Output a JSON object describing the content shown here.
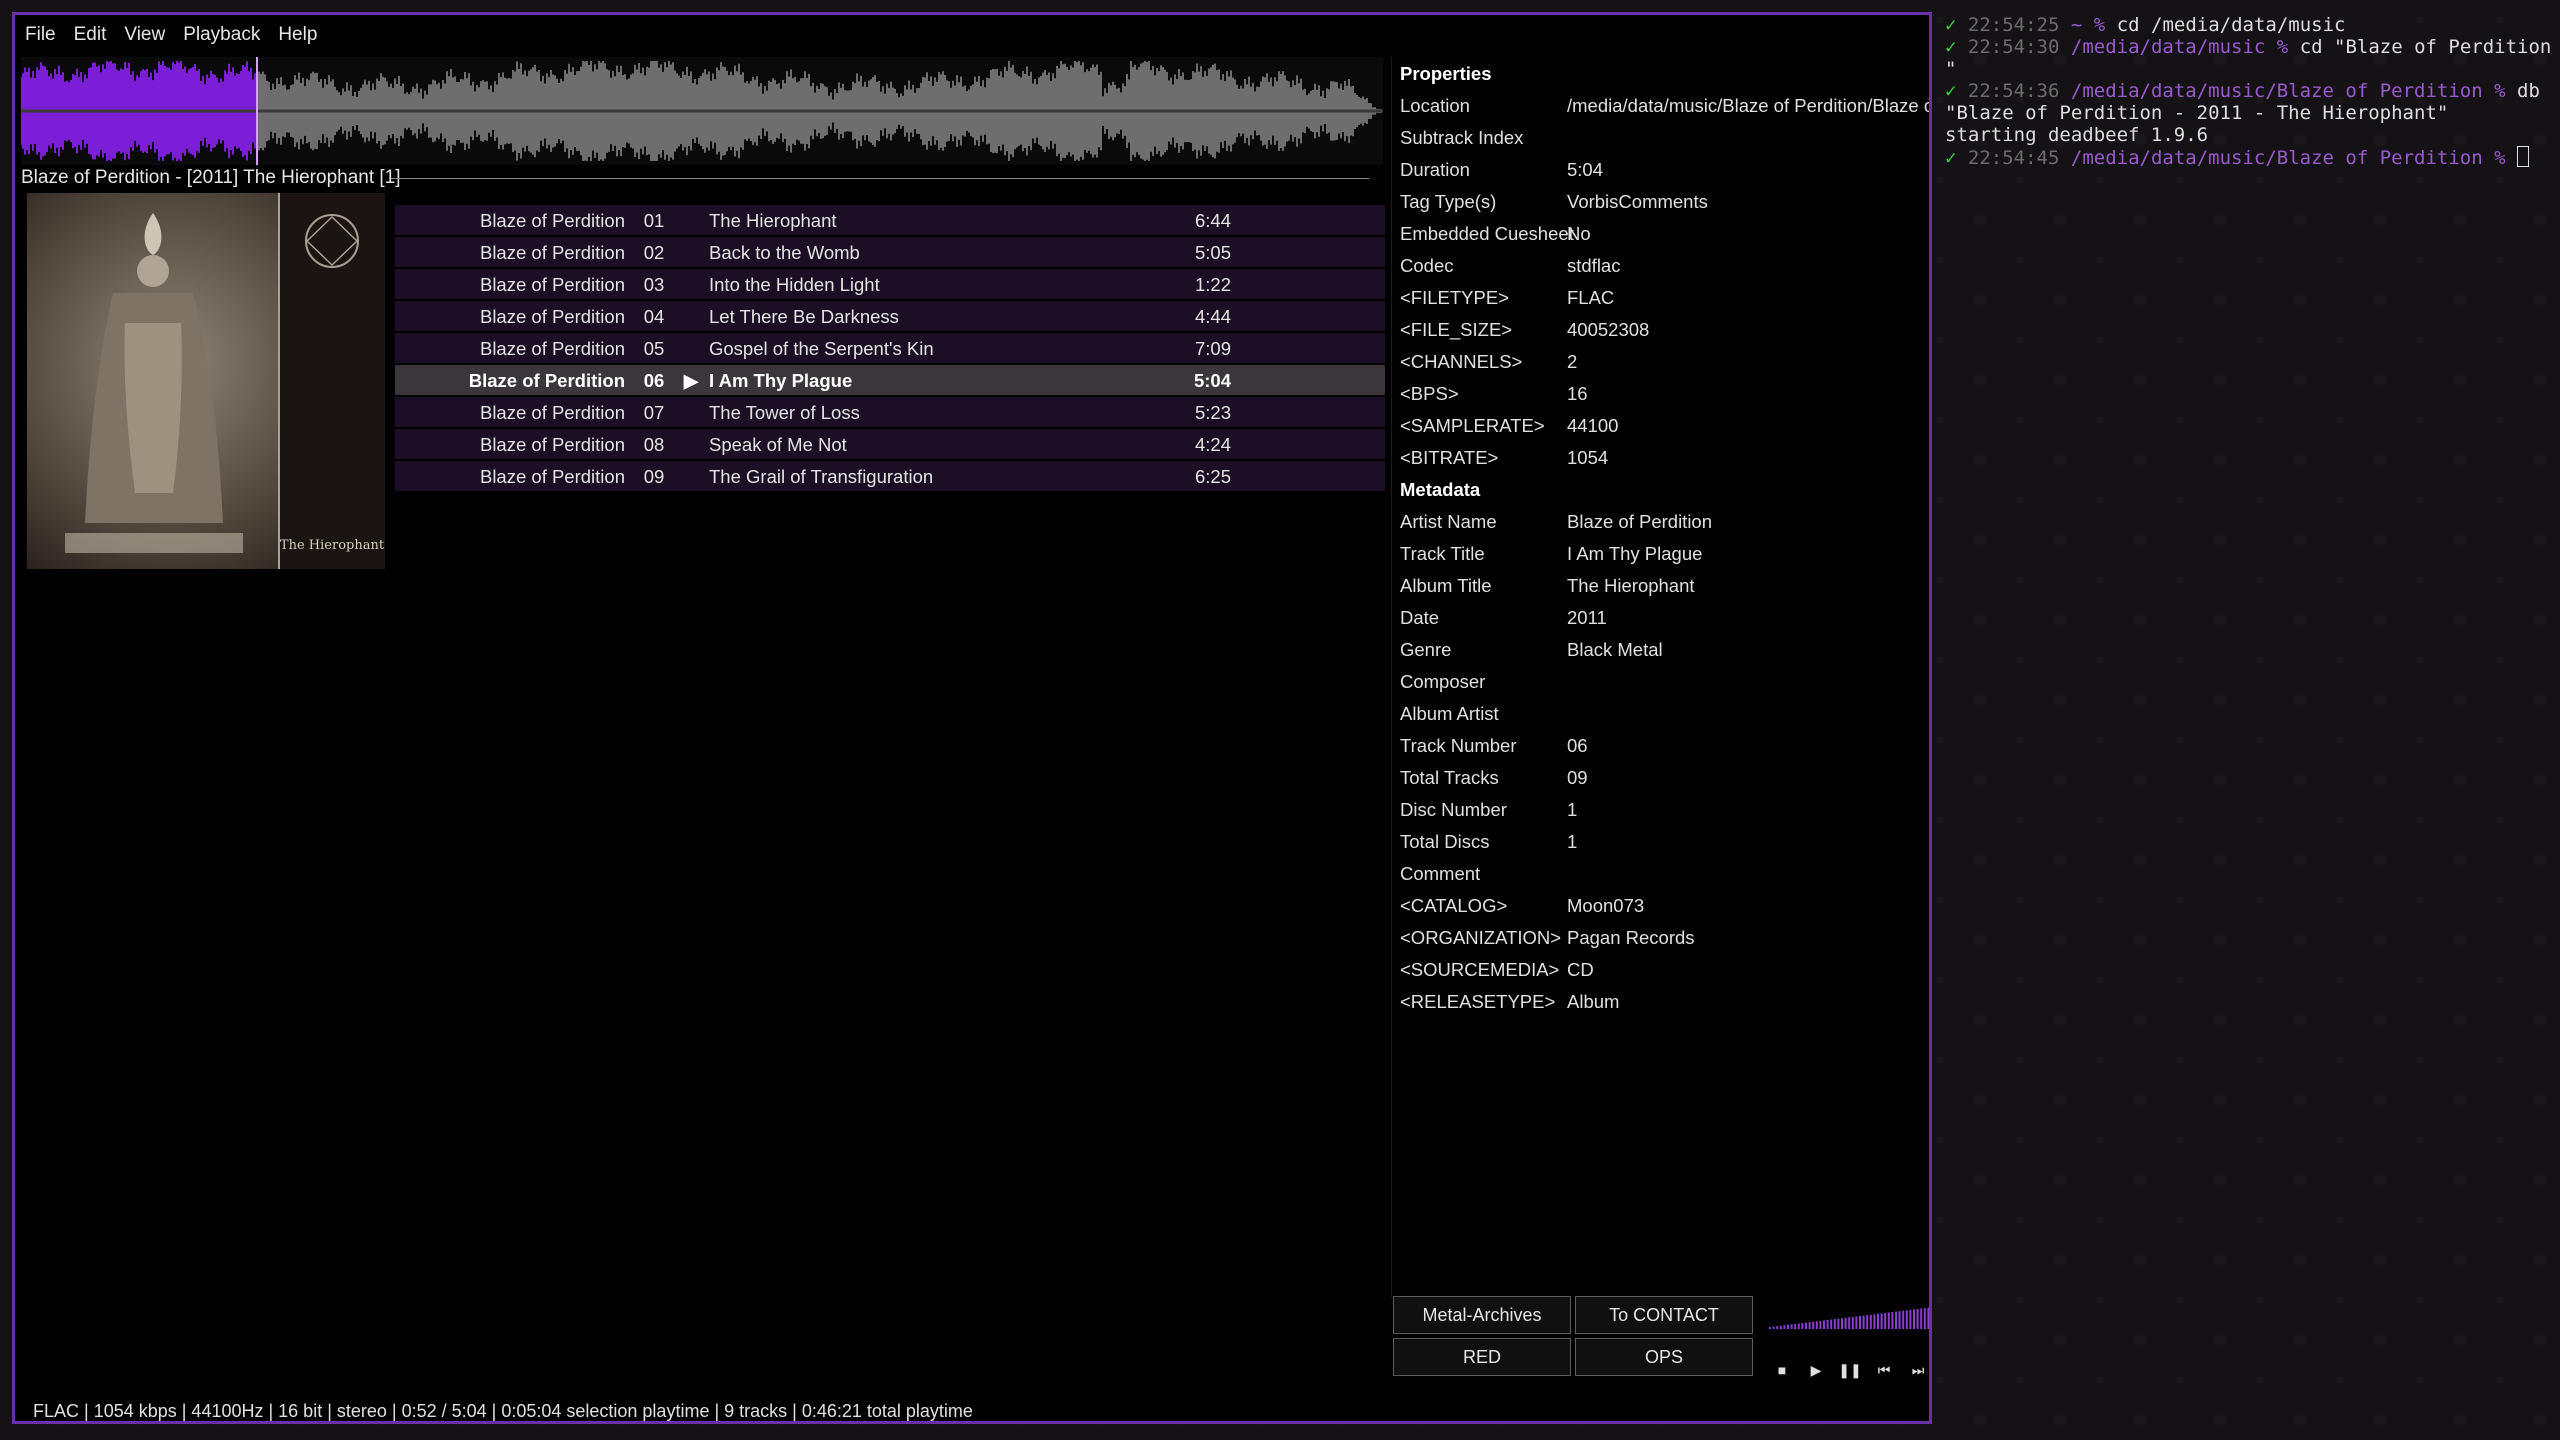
{
  "menu": [
    "File",
    "Edit",
    "View",
    "Playback",
    "Help"
  ],
  "playlist": {
    "title": "Blaze of Perdition - [2011] The Hierophant [1]",
    "cover_text": "The Hierophant",
    "playing_indicator": "▶",
    "tracks": [
      {
        "artist": "Blaze of Perdition",
        "num": "01",
        "title": "The Hierophant",
        "duration": "6:44",
        "playing": false
      },
      {
        "artist": "Blaze of Perdition",
        "num": "02",
        "title": "Back to the Womb",
        "duration": "5:05",
        "playing": false
      },
      {
        "artist": "Blaze of Perdition",
        "num": "03",
        "title": "Into the Hidden Light",
        "duration": "1:22",
        "playing": false
      },
      {
        "artist": "Blaze of Perdition",
        "num": "04",
        "title": "Let There Be Darkness",
        "duration": "4:44",
        "playing": false
      },
      {
        "artist": "Blaze of Perdition",
        "num": "05",
        "title": "Gospel of the Serpent's Kin",
        "duration": "7:09",
        "playing": false
      },
      {
        "artist": "Blaze of Perdition",
        "num": "06",
        "title": "I Am Thy Plague",
        "duration": "5:04",
        "playing": true
      },
      {
        "artist": "Blaze of Perdition",
        "num": "07",
        "title": "The Tower of Loss",
        "duration": "5:23",
        "playing": false
      },
      {
        "artist": "Blaze of Perdition",
        "num": "08",
        "title": "Speak of Me Not",
        "duration": "4:24",
        "playing": false
      },
      {
        "artist": "Blaze of Perdition",
        "num": "09",
        "title": "The Grail of Transfiguration",
        "duration": "6:25",
        "playing": false
      }
    ]
  },
  "waveform": {
    "progress": 0.173,
    "played_color": "#7a1fd6",
    "unplayed_color": "#6e6e6e"
  },
  "properties": {
    "heading": "Properties",
    "rows": [
      {
        "k": "Location",
        "v": "/media/data/music/Blaze of Perdition/Blaze of"
      },
      {
        "k": "Subtrack Index",
        "v": ""
      },
      {
        "k": "Duration",
        "v": "5:04"
      },
      {
        "k": "Tag Type(s)",
        "v": "VorbisComments"
      },
      {
        "k": "Embedded Cuesheet",
        "v": "No"
      },
      {
        "k": "Codec",
        "v": "stdflac"
      },
      {
        "k": "<FILETYPE>",
        "v": "FLAC"
      },
      {
        "k": "<FILE_SIZE>",
        "v": "40052308"
      },
      {
        "k": "<CHANNELS>",
        "v": "2"
      },
      {
        "k": "<BPS>",
        "v": "16"
      },
      {
        "k": "<SAMPLERATE>",
        "v": "44100"
      },
      {
        "k": "<BITRATE>",
        "v": "1054"
      }
    ]
  },
  "metadata": {
    "heading": "Metadata",
    "rows": [
      {
        "k": "Artist Name",
        "v": "Blaze of Perdition"
      },
      {
        "k": "Track Title",
        "v": "I Am Thy Plague"
      },
      {
        "k": "Album Title",
        "v": "The Hierophant"
      },
      {
        "k": "Date",
        "v": "2011"
      },
      {
        "k": "Genre",
        "v": "Black Metal"
      },
      {
        "k": "Composer",
        "v": ""
      },
      {
        "k": "Album Artist",
        "v": ""
      },
      {
        "k": "Track Number",
        "v": "06"
      },
      {
        "k": "Total Tracks",
        "v": "09"
      },
      {
        "k": "Disc Number",
        "v": "1"
      },
      {
        "k": "Total Discs",
        "v": "1"
      },
      {
        "k": "Comment",
        "v": ""
      },
      {
        "k": "<CATALOG>",
        "v": "Moon073"
      },
      {
        "k": "<ORGANIZATION>",
        "v": "Pagan Records"
      },
      {
        "k": "<SOURCEMEDIA>",
        "v": "CD"
      },
      {
        "k": "<RELEASETYPE>",
        "v": "Album"
      }
    ]
  },
  "buttons": {
    "metal_archives": "Metal-Archives",
    "to_contact": "To CONTACT",
    "red": "RED",
    "ops": "OPS"
  },
  "transport": {
    "stop": "■",
    "play": "▶",
    "pause": "❚❚",
    "prev": "⏮",
    "next": "⏭"
  },
  "volume": {
    "level": 0.95,
    "color": "#8a3fd0"
  },
  "statusbar": "FLAC | 1054 kbps | 44100Hz | 16 bit | stereo | 0:52 / 5:04 | 0:05:04 selection playtime | 9 tracks | 0:46:21 total playtime",
  "terminal": {
    "check": "✓",
    "lines": [
      {
        "time": "22:54:25",
        "path": "~",
        "prompt": "%",
        "cmd": "cd /media/data/music"
      },
      {
        "time": "22:54:30",
        "path": "/media/data/music",
        "prompt": "%",
        "cmd": "cd \"Blaze of Perdition"
      },
      {
        "cont": "\""
      },
      {
        "time": "22:54:36",
        "path": "/media/data/music/Blaze of Perdition",
        "prompt": "%",
        "cmd": "db"
      },
      {
        "cont": "\"Blaze of Perdition - 2011 - The Hierophant\""
      },
      {
        "cont": "starting deadbeef 1.9.6"
      },
      {
        "time": "22:54:45",
        "path": "/media/data/music/Blaze of Perdition",
        "prompt": "%",
        "cmd": "",
        "cursor": true
      }
    ]
  }
}
